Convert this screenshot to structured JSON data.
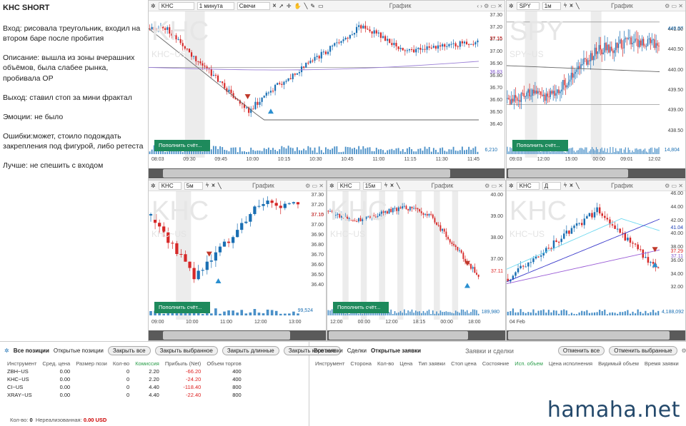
{
  "notes": {
    "title": "KHC SHORT",
    "entry": "Вход: рисовала треугольник, входил на втором баре после пробития",
    "description": "Описание: вышла из зоны вчерашних объёмов, была слабее рынка, пробивала ОР",
    "exit": "Выход: ставил стоп за мини фрактал",
    "emotions": "Эмоции: не было",
    "mistakes": "Ошибки:может, стоило подождать закрепления под фигурой, либо ретеста",
    "better": "Лучше: не спешить с входом"
  },
  "panels": {
    "p1": {
      "symbol": "KHC",
      "interval": "1 минута",
      "type": "Свечи",
      "title": "График",
      "wm": "KHC",
      "wm2": "KHC~US",
      "yticks": [
        "37.30",
        "37.20",
        "37.10",
        "37.00",
        "36.90",
        "36.80",
        "36.70",
        "36.60",
        "36.50",
        "36.40"
      ],
      "price": "37.15",
      "price2": "36.83",
      "xticks": [
        "08:03",
        "09:30",
        "09:45",
        "10:00",
        "10:15",
        "10:30",
        "10:45",
        "11:00",
        "11:15",
        "11:30",
        "11:45"
      ],
      "fund": "Пополнить счёт...",
      "vol": "6,210"
    },
    "p2": {
      "symbol": "SPY",
      "interval": "1м",
      "title": "График",
      "wm": "SPY",
      "wm2": "SPY~US",
      "yticks": [
        "441.00",
        "440.50",
        "440.00",
        "439.50",
        "439.00",
        "438.50"
      ],
      "price": "440.97",
      "xticks": [
        "09:03",
        "12:00",
        "15:00",
        "00:00",
        "09:01",
        "12:02"
      ],
      "fund": "Пополнить счёт...",
      "vol": "14,804"
    },
    "p3": {
      "symbol": "KHC",
      "interval": "5м",
      "title": "График",
      "wm": "KHC",
      "wm2": "KHC~US",
      "yticks": [
        "37.30",
        "37.20",
        "37.10",
        "37.00",
        "36.90",
        "36.80",
        "36.70",
        "36.60",
        "36.50",
        "36.40"
      ],
      "price": "37.15",
      "xticks": [
        "09:00",
        "10:00",
        "11:00",
        "12:00",
        "13:00"
      ],
      "fund": "Пополнить счёт...",
      "vol": "99,524"
    },
    "p4": {
      "symbol": "KHC",
      "interval": "15м",
      "title": "График",
      "wm": "KHC",
      "wm2": "KHC~US",
      "yticks": [
        "40.00",
        "39.00",
        "38.00",
        "37.00"
      ],
      "price": "37.11",
      "xticks": [
        "12:00",
        "00:00",
        "12:00",
        "18:15",
        "00:00",
        "18:00"
      ],
      "fund": "Пополнить счёт...",
      "vol": "189,980"
    },
    "p5": {
      "symbol": "KHC",
      "interval": "Д",
      "title": "График",
      "wm": "KHC",
      "wm2": "KHC~US",
      "yticks": [
        "46.00",
        "44.00",
        "42.00",
        "40.00",
        "38.00",
        "36.00",
        "34.00",
        "32.00"
      ],
      "price": "41.04",
      "price2": "37.29",
      "price3": "37.11",
      "xticks": [
        "04 Feb"
      ],
      "fund": "Пополнить счёт...",
      "vol": "4,188,092"
    }
  },
  "positions": {
    "tabs": [
      "Все позиции",
      "Открытые позиции"
    ],
    "buttons": [
      "Закрыть все",
      "Закрыть выбранное",
      "Закрыть длинные",
      "Закрыть короткие"
    ],
    "columns": [
      "Инструмент",
      "Сред. цена",
      "Размер пози",
      "Кол-во",
      "Комиссия",
      "Прибыль (Net)",
      "Объем торгов"
    ],
    "rows": [
      [
        "ZBH~US",
        "0.00",
        "",
        "0",
        "2.20",
        "-66.20",
        "400"
      ],
      [
        "KHC~US",
        "0.00",
        "",
        "0",
        "2.20",
        "-24.20",
        "400"
      ],
      [
        "CI~US",
        "0.00",
        "",
        "0",
        "4.40",
        "-118.40",
        "800"
      ],
      [
        "XRAY~US",
        "0.00",
        "",
        "0",
        "4.40",
        "-22.40",
        "800"
      ]
    ],
    "footer_label": "Кол-во:",
    "footer_count": "0",
    "footer_unreal": "Нереализованная:",
    "footer_value": "0.00 USD"
  },
  "orders": {
    "tabs": [
      "Все заявки",
      "Сделки",
      "Открытые заявки"
    ],
    "title": "Заявки и сделки",
    "buttons": [
      "Отменить все",
      "Отменить выбранные"
    ],
    "columns": [
      "Инструмент",
      "Сторона",
      "Кол-во",
      "Цена",
      "Тип заявки",
      "Стоп цена",
      "Состояние",
      "Исп. объем",
      "Цена исполнения",
      "Видимый объем",
      "Время заявки"
    ]
  },
  "brand": "hamaha.net",
  "colors": {
    "up": "#1a6fb3",
    "down": "#d62828",
    "fund": "#1e8a5c"
  }
}
